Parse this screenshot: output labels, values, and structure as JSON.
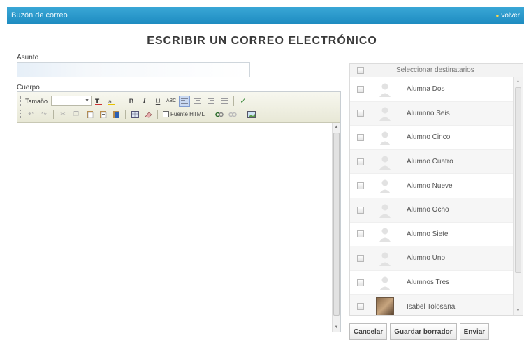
{
  "header": {
    "title": "Buzón de correo",
    "back_label": "volver"
  },
  "page_title": "ESCRIBIR UN CORREO ELECTRÓNICO",
  "form": {
    "asunto_label": "Asunto",
    "asunto_value": "",
    "cuerpo_label": "Cuerpo"
  },
  "toolbar": {
    "size_label": "Tamaño",
    "size_value": "",
    "html_label": "Fuente HTML"
  },
  "recipients": {
    "header_label": "Seleccionar destinatarios",
    "items": [
      {
        "name": "Alumna Dos",
        "avatar": "default-user-icon"
      },
      {
        "name": "Alumnno Seis",
        "avatar": "default-user-icon"
      },
      {
        "name": "Alumno Cinco",
        "avatar": "default-user-icon"
      },
      {
        "name": "Alumno Cuatro",
        "avatar": "default-user-icon"
      },
      {
        "name": "Alumno Nueve",
        "avatar": "default-user-icon"
      },
      {
        "name": "Alumno Ocho",
        "avatar": "default-user-icon"
      },
      {
        "name": "Alumno Siete",
        "avatar": "default-user-icon"
      },
      {
        "name": "Alumno Uno",
        "avatar": "default-user-icon"
      },
      {
        "name": "Alumnos Tres",
        "avatar": "default-user-icon"
      },
      {
        "name": "Isabel Tolosana",
        "avatar": "user-photo"
      }
    ]
  },
  "actions": {
    "cancel": "Cancelar",
    "save_draft": "Guardar borrador",
    "send": "Enviar"
  },
  "colors": {
    "header_bar": "#2a9bd0",
    "toolbar_bg": "#efefe0"
  }
}
